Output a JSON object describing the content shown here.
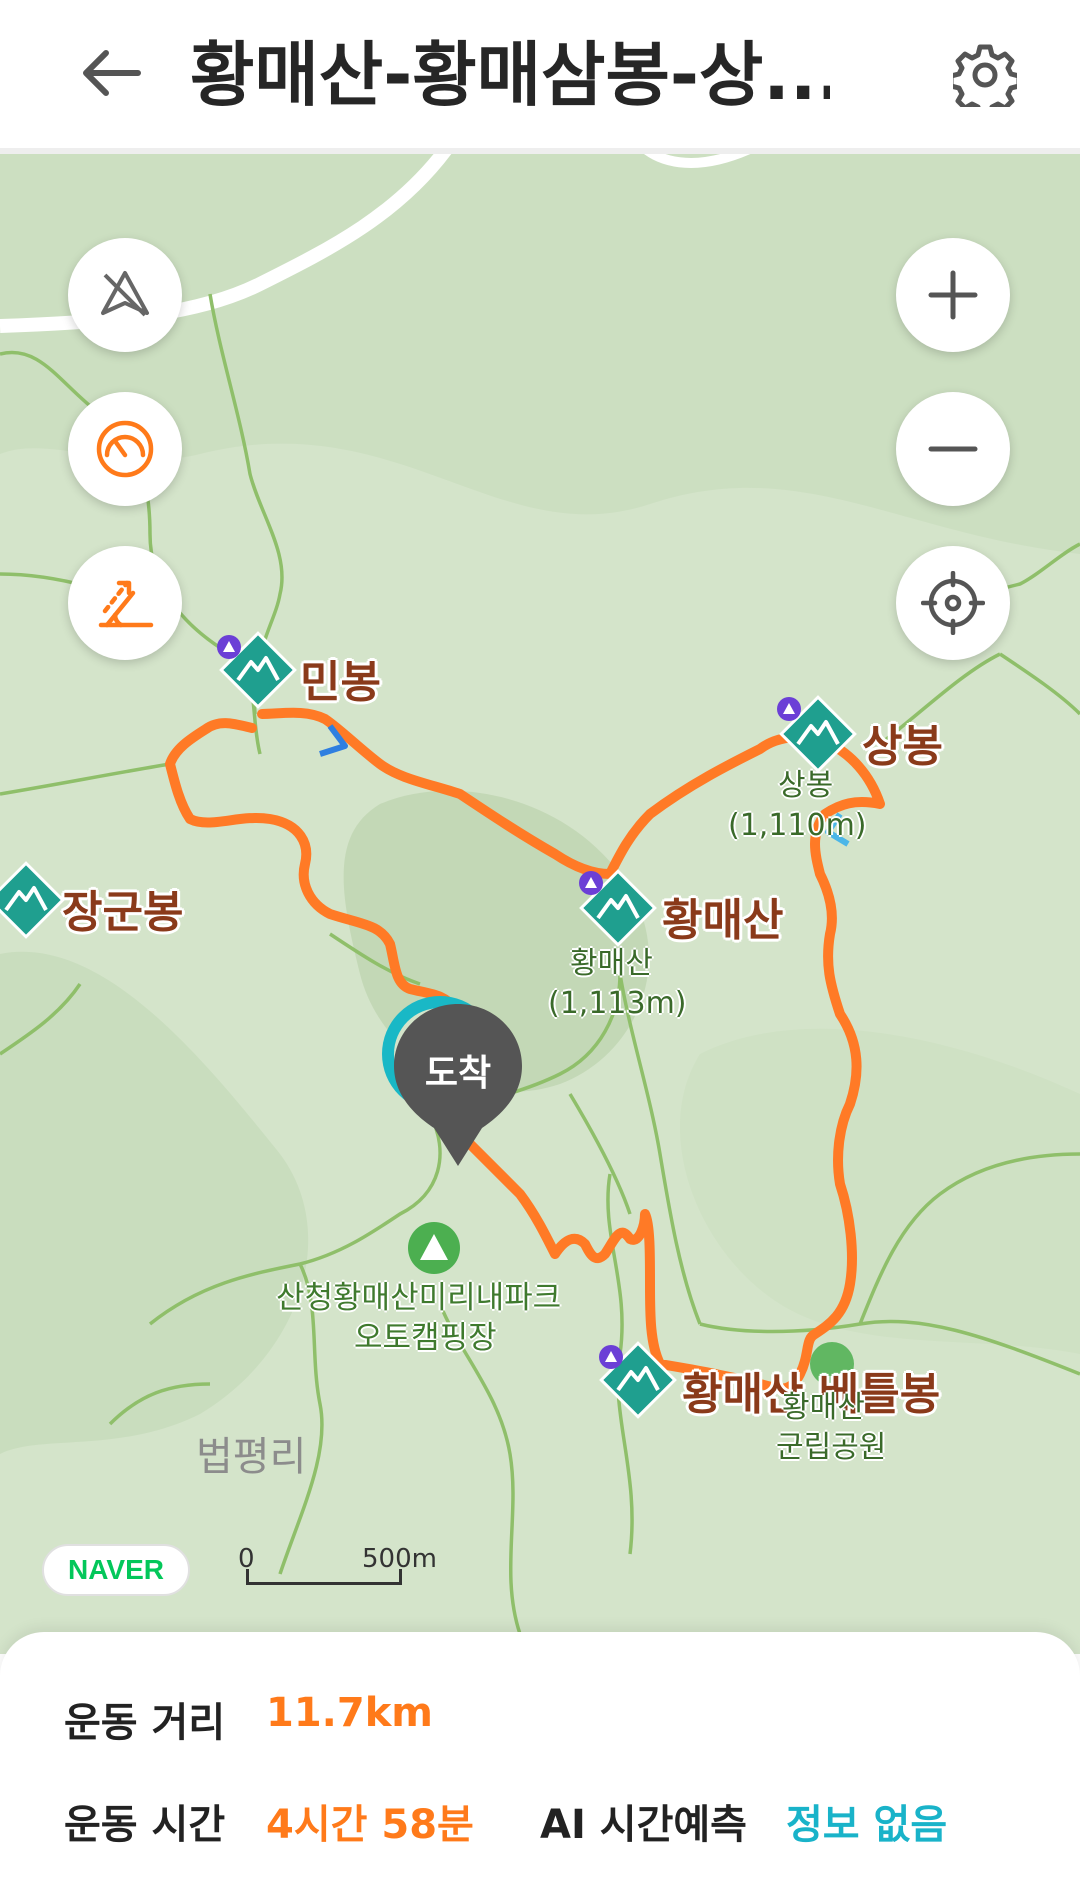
{
  "header": {
    "title": "황매산-황매삼봉-상...",
    "back_icon": "back-arrow-icon",
    "settings_icon": "gear-icon"
  },
  "map": {
    "peaks": {
      "minbong": "민봉",
      "sangbong": "상봉",
      "hwangmaesan": "황매산",
      "janggunbong": "장군봉",
      "betteulbong": "황매산 베틀봉"
    },
    "sublabels": {
      "sangbong_name": "상봉",
      "sangbong_elev": "(1,110m)",
      "hwangmaesan_name": "황매산",
      "hwangmaesan_elev": "(1,113m)",
      "park_line1": "황매산",
      "park_line2": "군립공원"
    },
    "camp_line1": "산청황매산미리내파크",
    "camp_line2": "오토캠핑장",
    "village": "법평리",
    "arrival": "도착",
    "logo": "NAVER",
    "scale_start": "0",
    "scale_end": "500m",
    "colors": {
      "route": "#ff7a26",
      "peak_marker": "#1f9f8f",
      "accent_orange": "#ff7a1a",
      "accent_teal": "#19b3c9"
    }
  },
  "stats": {
    "distance_label": "운동 거리",
    "distance_value": "11.7km",
    "time_label": "운동 시간",
    "time_value": "4시간 58분",
    "ai_label": "AI 시간예측",
    "ai_value": "정보 없음"
  }
}
